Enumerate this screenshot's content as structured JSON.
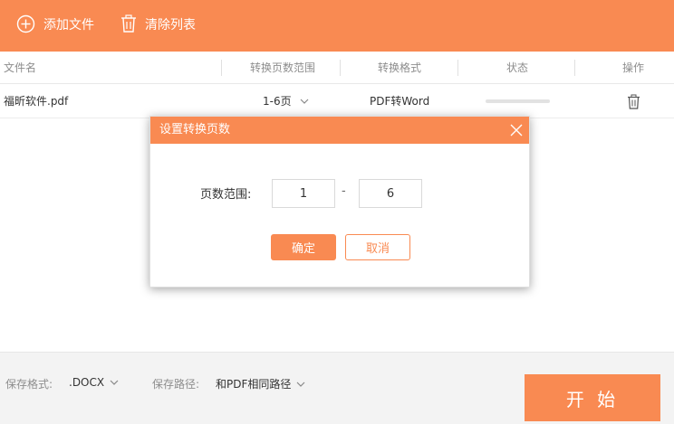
{
  "toolbar": {
    "add_file_label": "添加文件",
    "clear_list_label": "清除列表"
  },
  "table": {
    "headers": {
      "filename": "文件名",
      "page_range": "转换页数范围",
      "format": "转换格式",
      "status": "状态",
      "action": "操作"
    },
    "rows": [
      {
        "filename": "福昕软件.pdf",
        "page_range": "1-6页",
        "format": "PDF转Word",
        "progress_percent": 0
      }
    ]
  },
  "footer": {
    "save_format_label": "保存格式:",
    "save_format_value": ".DOCX",
    "save_path_label": "保存路径:",
    "save_path_value": "和PDF相同路径",
    "start_label": "开 始"
  },
  "dialog": {
    "title": "设置转换页数",
    "range_label": "页数范围:",
    "from_value": "1",
    "dash": "-",
    "to_value": "6",
    "ok_label": "确定",
    "cancel_label": "取消"
  },
  "colors": {
    "accent": "#f98a52",
    "footer_bg": "#f3f3f3"
  }
}
